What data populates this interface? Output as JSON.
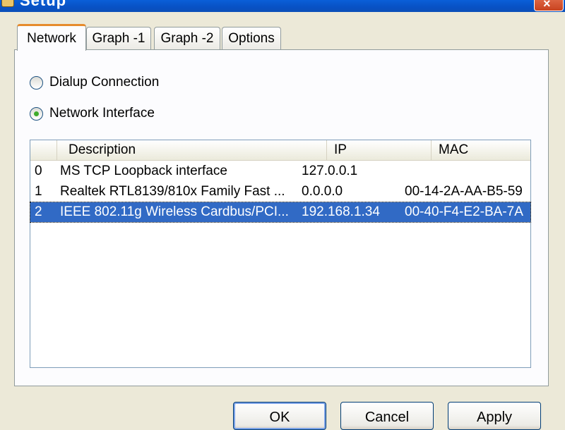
{
  "window": {
    "title": "Setup",
    "close_glyph": "×",
    "icon": "setup-app-icon"
  },
  "tabs": [
    {
      "label": "Network",
      "active": true
    },
    {
      "label": "Graph -1",
      "active": false
    },
    {
      "label": "Graph -2",
      "active": false
    },
    {
      "label": "Options",
      "active": false
    }
  ],
  "connection": {
    "options": [
      {
        "label": "Dialup Connection",
        "checked": false
      },
      {
        "label": "Network Interface",
        "checked": true
      }
    ]
  },
  "interfaces": {
    "columns": [
      "",
      "Description",
      "IP",
      "MAC"
    ],
    "rows": [
      {
        "index": "0",
        "description": "MS TCP Loopback interface",
        "ip": "127.0.0.1",
        "mac": ""
      },
      {
        "index": "1",
        "description": "Realtek RTL8139/810x Family Fast ...",
        "ip": "0.0.0.0",
        "mac": "00-14-2A-AA-B5-59"
      },
      {
        "index": "2",
        "description": "IEEE 802.11g Wireless Cardbus/PCI...",
        "ip": "192.168.1.34",
        "mac": "00-40-F4-E2-BA-7A",
        "selected": true
      }
    ]
  },
  "buttons": {
    "ok": "OK",
    "cancel": "Cancel",
    "apply": "Apply"
  },
  "colors": {
    "selection": "#316ac5",
    "tab_highlight": "#e68b2c",
    "radio_dot": "#3fab2c"
  }
}
